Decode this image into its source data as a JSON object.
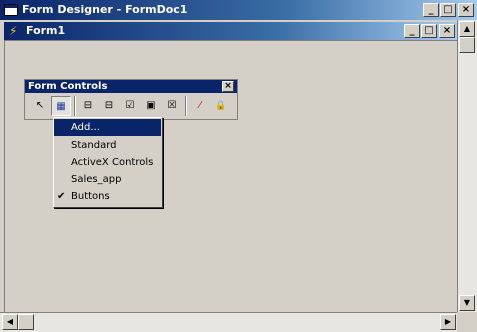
{
  "app": {
    "title": "Form Designer - FormDoc1",
    "window_controls": {
      "minimize": "_",
      "maximize": "□",
      "close": "×"
    }
  },
  "child_window": {
    "title": "Form1",
    "window_controls": {
      "minimize": "_",
      "maximize": "□",
      "close": "×"
    }
  },
  "form_controls": {
    "title": "Form Controls",
    "close_glyph": "×",
    "tools": [
      {
        "icon": "pointer-icon",
        "glyph": "↖"
      },
      {
        "icon": "add-control-icon",
        "glyph": "▦"
      },
      {
        "icon": "text-box-icon",
        "glyph": "⊟"
      },
      {
        "icon": "frame-icon",
        "glyph": "⊟"
      },
      {
        "icon": "check-box-icon",
        "glyph": "☑"
      },
      {
        "icon": "option-icon",
        "glyph": "▣"
      },
      {
        "icon": "list-icon",
        "glyph": "☒"
      },
      {
        "icon": "wand-icon",
        "glyph": "⁄"
      },
      {
        "icon": "lock-icon",
        "glyph": "🔒"
      }
    ]
  },
  "menu": {
    "items": [
      {
        "label": "Add...",
        "selected": true,
        "checked": false
      },
      {
        "label": "Standard",
        "selected": false,
        "checked": false
      },
      {
        "label": "ActiveX Controls",
        "selected": false,
        "checked": false
      },
      {
        "label": "Sales_app",
        "selected": false,
        "checked": false
      },
      {
        "label": "Buttons",
        "selected": false,
        "checked": true
      }
    ],
    "check_glyph": "✔"
  },
  "scrollbars": {
    "up": "▲",
    "down": "▼",
    "left": "◀",
    "right": "▶"
  }
}
